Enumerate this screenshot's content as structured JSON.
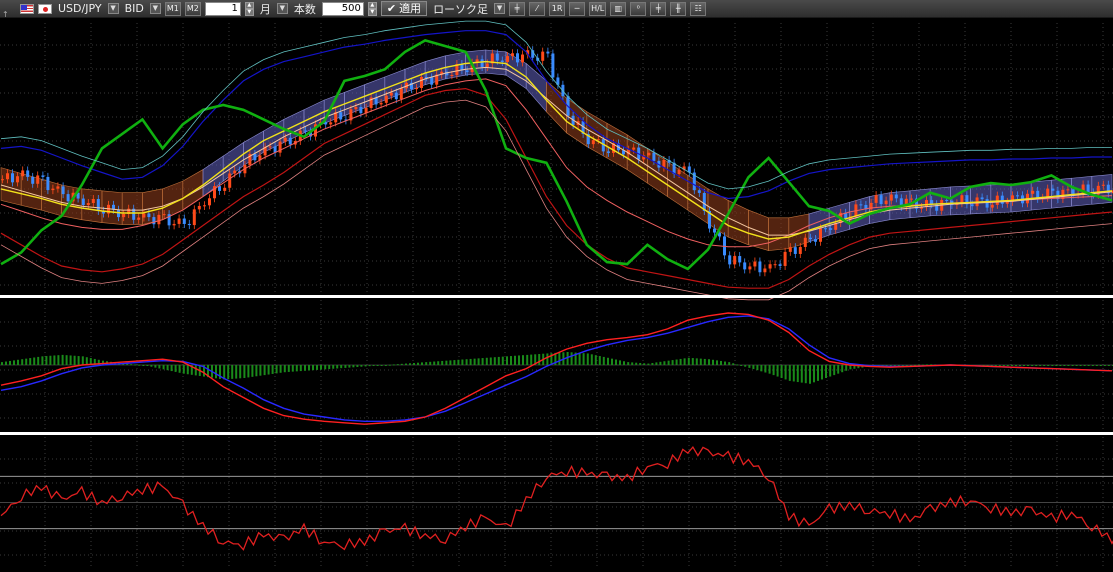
{
  "toolbar": {
    "symbol": "USD/JPY",
    "price_type": "BID",
    "period_count": "1",
    "period_unit": "月",
    "bars_label": "本数",
    "bars_count": "500",
    "apply_label": "適用",
    "chart_type": "ローソク足",
    "buttons": [
      "M1",
      "M2",
      "1R",
      "H/L"
    ]
  },
  "colors": {
    "background": "#000000",
    "bull_candle": "#ff4a1a",
    "bear_candle": "#3a8cff",
    "chikou": "#10b010",
    "ma_fast": "#f2e21a",
    "ma_slow": "#f5c8a0",
    "bollinger_outer": "#c01414",
    "bollinger_mid": "#f06060",
    "bollinger_inner": "#1414c8",
    "cloud_bull": "#5a5ab0",
    "cloud_bear": "#8a3a1a",
    "macd_line": "#ff2020",
    "signal_line": "#2828ff",
    "histogram": "#1a8a1a",
    "rsi": "#e02020",
    "separator": "#ffffff"
  },
  "chart_data": [
    {
      "type": "line",
      "panel": "price",
      "x": [
        0,
        20,
        40,
        60,
        80,
        100,
        120,
        140,
        160,
        180,
        200,
        220,
        240,
        260,
        280,
        300,
        320,
        340,
        360,
        380,
        400,
        420,
        440,
        460,
        480,
        500,
        520,
        540,
        560,
        580,
        600,
        620,
        640,
        660,
        680,
        700,
        720,
        740,
        760,
        780,
        800,
        820,
        840,
        860,
        880,
        900,
        920,
        940,
        960,
        980,
        1000,
        1020,
        1040,
        1060,
        1080,
        1100
      ],
      "series": [
        {
          "key": "close",
          "values": [
            118,
            122,
            115,
            102,
            96,
            88,
            83,
            78,
            76,
            70,
            95,
            115,
            135,
            148,
            155,
            165,
            178,
            185,
            195,
            202,
            212,
            220,
            228,
            235,
            242,
            244,
            246,
            244,
            185,
            160,
            150,
            148,
            140,
            130,
            125,
            72,
            35,
            28,
            25,
            42,
            55,
            70,
            85,
            95,
            98,
            92,
            90,
            95,
            96,
            94,
            98,
            100,
            103,
            105,
            108,
            110
          ]
        },
        {
          "key": "ma_fast",
          "values": [
            108,
            103,
            98,
            92,
            88,
            85,
            83,
            83,
            88,
            98,
            112,
            128,
            144,
            158,
            168,
            178,
            188,
            196,
            204,
            212,
            220,
            228,
            234,
            238,
            240,
            238,
            224,
            200,
            178,
            164,
            152,
            140,
            126,
            112,
            98,
            84,
            70,
            62,
            56,
            58,
            65,
            72,
            78,
            84,
            88,
            90,
            92,
            93,
            94,
            95,
            96,
            98,
            100,
            102,
            104,
            106
          ]
        },
        {
          "key": "ma_slow",
          "values": [
            112,
            106,
            100,
            94,
            90,
            88,
            86,
            86,
            90,
            98,
            110,
            124,
            138,
            150,
            162,
            172,
            182,
            190,
            198,
            206,
            214,
            222,
            228,
            232,
            234,
            232,
            220,
            202,
            184,
            170,
            158,
            146,
            132,
            118,
            104,
            90,
            78,
            68,
            60,
            60,
            64,
            70,
            76,
            82,
            86,
            88,
            90,
            92,
            93,
            94,
            95,
            97,
            99,
            101,
            103,
            105
          ]
        },
        {
          "key": "chikou",
          "values": [
            30,
            42,
            65,
            80,
            112,
            150,
            165,
            180,
            150,
            175,
            190,
            195,
            190,
            180,
            170,
            162,
            178,
            220,
            225,
            232,
            250,
            262,
            256,
            250,
            210,
            150,
            140,
            135,
            95,
            50,
            32,
            30,
            50,
            35,
            25,
            45,
            82,
            120,
            140,
            115,
            90,
            85,
            72,
            82,
            88,
            92,
            104,
            98,
            110,
            114,
            112,
            115,
            122,
            110,
            102,
            96
          ]
        },
        {
          "key": "boll_upper",
          "values": [
            62,
            50,
            38,
            28,
            24,
            22,
            25,
            30,
            40,
            55,
            70,
            85,
            100,
            112,
            125,
            140,
            155,
            165,
            175,
            185,
            195,
            205,
            210,
            212,
            205,
            180,
            140,
            100,
            70,
            50,
            36,
            26,
            22,
            18,
            14,
            10,
            6,
            5,
            5,
            14,
            28,
            40,
            50,
            58,
            62,
            64,
            66,
            68,
            70,
            72,
            74,
            76,
            78,
            80,
            82,
            84
          ]
        },
        {
          "key": "boll_mid",
          "values": [
            92,
            85,
            78,
            72,
            68,
            66,
            66,
            70,
            76,
            86,
            100,
            114,
            128,
            140,
            150,
            160,
            170,
            178,
            186,
            194,
            202,
            210,
            216,
            220,
            222,
            215,
            190,
            160,
            130,
            110,
            96,
            84,
            74,
            64,
            56,
            50,
            48,
            48,
            52,
            60,
            70,
            78,
            84,
            88,
            90,
            91,
            92,
            93,
            94,
            95,
            96,
            97,
            98,
            99,
            100,
            101
          ]
        },
        {
          "key": "boll_lower",
          "values": [
            150,
            152,
            148,
            140,
            132,
            125,
            118,
            120,
            132,
            152,
            178,
            200,
            220,
            232,
            240,
            245,
            250,
            255,
            258,
            262,
            265,
            268,
            270,
            272,
            272,
            268,
            250,
            220,
            195,
            175,
            160,
            150,
            140,
            128,
            116,
            104,
            98,
            100,
            106,
            116,
            124,
            128,
            130,
            132,
            134,
            135,
            136,
            137,
            138,
            138,
            139,
            139,
            140,
            140,
            141,
            141
          ]
        }
      ],
      "ylim": [
        0,
        280
      ]
    },
    {
      "type": "bar",
      "panel": "macd",
      "x": [
        0,
        20,
        40,
        60,
        80,
        100,
        120,
        140,
        160,
        180,
        200,
        220,
        240,
        260,
        280,
        300,
        320,
        340,
        360,
        380,
        400,
        420,
        440,
        460,
        480,
        500,
        520,
        540,
        560,
        580,
        600,
        620,
        640,
        660,
        680,
        700,
        720,
        740,
        760,
        780,
        800,
        820,
        840,
        860,
        880,
        900,
        920,
        940,
        960,
        980,
        1000,
        1020,
        1040,
        1060,
        1080,
        1100
      ],
      "series": [
        {
          "key": "macd",
          "values": [
            -28,
            -22,
            -15,
            -5,
            0,
            2,
            4,
            6,
            8,
            4,
            -10,
            -30,
            -45,
            -60,
            -70,
            -75,
            -78,
            -80,
            -82,
            -80,
            -78,
            -72,
            -60,
            -45,
            -30,
            -15,
            -5,
            10,
            22,
            30,
            35,
            38,
            42,
            50,
            62,
            68,
            72,
            70,
            62,
            45,
            20,
            5,
            0,
            -2,
            -3,
            -2,
            -1,
            0,
            -1,
            -2,
            -3,
            -4,
            -5,
            -6,
            -7,
            -8
          ]
        },
        {
          "key": "signal",
          "values": [
            -35,
            -30,
            -22,
            -12,
            -4,
            0,
            2,
            4,
            6,
            5,
            -2,
            -18,
            -32,
            -48,
            -60,
            -68,
            -72,
            -76,
            -78,
            -78,
            -76,
            -72,
            -64,
            -52,
            -40,
            -28,
            -16,
            -2,
            10,
            20,
            28,
            34,
            38,
            44,
            52,
            60,
            66,
            68,
            64,
            50,
            28,
            10,
            2,
            -1,
            -2,
            -2,
            -1,
            0,
            -1,
            -2,
            -3,
            -4,
            -5,
            -6,
            -7,
            -8
          ]
        },
        {
          "key": "histogram",
          "values": [
            4,
            8,
            12,
            14,
            12,
            6,
            2,
            0,
            -6,
            -12,
            -16,
            -20,
            -18,
            -14,
            -10,
            -8,
            -6,
            -4,
            -2,
            0,
            2,
            4,
            6,
            8,
            10,
            12,
            14,
            16,
            18,
            16,
            10,
            4,
            2,
            6,
            10,
            8,
            4,
            -4,
            -12,
            -22,
            -26,
            -16,
            -6,
            -2,
            -1,
            0,
            1,
            0,
            -1,
            0,
            0,
            0,
            0,
            0,
            0,
            0
          ]
        }
      ],
      "ylim": [
        -90,
        90
      ]
    },
    {
      "type": "line",
      "panel": "rsi",
      "x": [
        0,
        20,
        40,
        60,
        80,
        100,
        120,
        140,
        160,
        180,
        200,
        220,
        240,
        260,
        280,
        300,
        320,
        340,
        360,
        380,
        400,
        420,
        440,
        460,
        480,
        500,
        520,
        540,
        560,
        580,
        600,
        620,
        640,
        660,
        680,
        700,
        720,
        740,
        760,
        780,
        800,
        820,
        840,
        860,
        880,
        900,
        920,
        940,
        960,
        980,
        1000,
        1020,
        1040,
        1060,
        1080,
        1100
      ],
      "series": [
        {
          "key": "rsi",
          "values": [
            40,
            55,
            62,
            52,
            58,
            50,
            55,
            60,
            62,
            48,
            32,
            20,
            18,
            25,
            22,
            30,
            20,
            18,
            20,
            28,
            30,
            25,
            22,
            32,
            38,
            30,
            52,
            70,
            74,
            72,
            70,
            68,
            78,
            80,
            90,
            88,
            85,
            82,
            70,
            40,
            32,
            45,
            48,
            44,
            42,
            36,
            45,
            50,
            52,
            46,
            42,
            44,
            38,
            42,
            32,
            22
          ]
        }
      ],
      "ylim": [
        0,
        100
      ],
      "levels": [
        30,
        70
      ]
    }
  ]
}
